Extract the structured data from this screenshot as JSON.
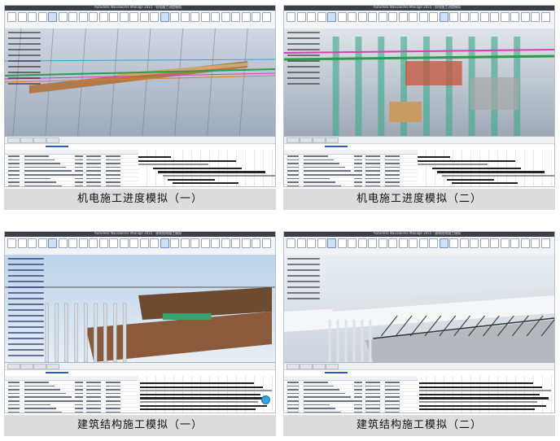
{
  "panels": [
    {
      "caption": "机电施工进度模拟（一）",
      "window_title": "Autodesk Navisworks Manage 2015 · 机电施工进度模拟",
      "scene": "mep-1",
      "colors": {
        "bg_top": "#c9d1de",
        "bg_bottom": "#8e9bb0"
      }
    },
    {
      "caption": "机电施工进度模拟（二）",
      "window_title": "Autodesk Navisworks Manage 2015 · 机电施工进度模拟",
      "scene": "mep-2",
      "colors": {
        "bg_top": "#dfe5ea",
        "bg_bottom": "#9fa9b6"
      }
    },
    {
      "caption": "建筑结构施工模拟（一）",
      "window_title": "Autodesk Navisworks Manage 2015 · 建筑结构施工模拟",
      "scene": "struct-1",
      "colors": {
        "bg_top": "#bcd3ea",
        "bg_bottom": "#e8eef4"
      }
    },
    {
      "caption": "建筑结构施工模拟（二）",
      "window_title": "Autodesk Navisworks Manage 2015 · 建筑结构施工模拟",
      "scene": "struct-2",
      "colors": {
        "bg_top": "#e9eef3",
        "bg_bottom": "#cdd4dc"
      }
    }
  ],
  "caption_bg": "#dcdcdc"
}
